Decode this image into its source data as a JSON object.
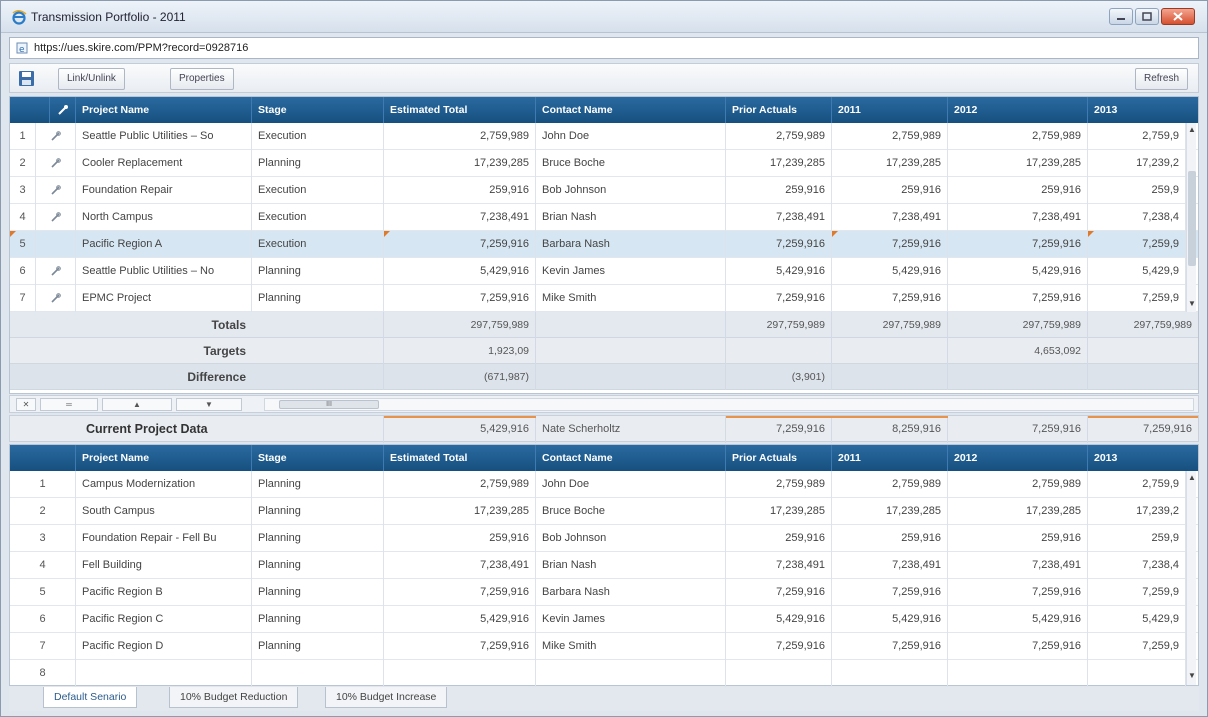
{
  "window": {
    "title": "Transmission Portfolio - 2011",
    "url": "https://ues.skire.com/PPM?record=0928716"
  },
  "toolbar": {
    "link_unlink": "Link/Unlink",
    "properties": "Properties",
    "refresh": "Refresh"
  },
  "columns": [
    "Project Name",
    "Stage",
    "Estimated Total",
    "Contact Name",
    "Prior Actuals",
    "2011",
    "2012",
    "2013"
  ],
  "top_rows": [
    {
      "idx": "1",
      "linked": true,
      "name": "Seattle Public Utilities – So",
      "stage": "Execution",
      "est": "2,759,989",
      "contact": "John Doe",
      "prior": "2,759,989",
      "y2011": "2,759,989",
      "y2012": "2,759,989",
      "y2013": "2,759,9"
    },
    {
      "idx": "2",
      "linked": true,
      "name": "Cooler Replacement",
      "stage": "Planning",
      "est": "17,239,285",
      "contact": "Bruce Boche",
      "prior": "17,239,285",
      "y2011": "17,239,285",
      "y2012": "17,239,285",
      "y2013": "17,239,2"
    },
    {
      "idx": "3",
      "linked": true,
      "name": "Foundation Repair",
      "stage": "Execution",
      "est": "259,916",
      "contact": "Bob Johnson",
      "prior": "259,916",
      "y2011": "259,916",
      "y2012": "259,916",
      "y2013": "259,9"
    },
    {
      "idx": "4",
      "linked": true,
      "name": "North Campus",
      "stage": "Execution",
      "est": "7,238,491",
      "contact": "Brian Nash",
      "prior": "7,238,491",
      "y2011": "7,238,491",
      "y2012": "7,238,491",
      "y2013": "7,238,4"
    },
    {
      "idx": "5",
      "linked": false,
      "name": "Pacific Region A",
      "stage": "Execution",
      "est": "7,259,916",
      "contact": "Barbara Nash",
      "prior": "7,259,916",
      "y2011": "7,259,916",
      "y2012": "7,259,916",
      "y2013": "7,259,9"
    },
    {
      "idx": "6",
      "linked": true,
      "name": "Seattle Public Utilities – No",
      "stage": "Planning",
      "est": "5,429,916",
      "contact": "Kevin James",
      "prior": "5,429,916",
      "y2011": "5,429,916",
      "y2012": "5,429,916",
      "y2013": "5,429,9"
    },
    {
      "idx": "7",
      "linked": true,
      "name": "EPMC Project",
      "stage": "Planning",
      "est": "7,259,916",
      "contact": "Mike Smith",
      "prior": "7,259,916",
      "y2011": "7,259,916",
      "y2012": "7,259,916",
      "y2013": "7,259,9"
    }
  ],
  "totals": {
    "label": "Totals",
    "est": "297,759,989",
    "prior": "297,759,989",
    "y2011": "297,759,989",
    "y2012": "297,759,989",
    "y2013": "297,759,989"
  },
  "targets": {
    "label": "Targets",
    "est": "1,923,09",
    "y2012": "4,653,092"
  },
  "difference": {
    "label": "Difference",
    "est": "(671,987)",
    "prior": "(3,901)"
  },
  "splitter": {
    "thumb": "III"
  },
  "current": {
    "label": "Current Project Data",
    "est": "5,429,916",
    "contact": "Nate Scherholtz",
    "prior": "7,259,916",
    "y2011": "8,259,916",
    "y2012": "7,259,916",
    "y2013": "7,259,916"
  },
  "bottom_rows": [
    {
      "idx": "1",
      "name": "Campus Modernization",
      "stage": "Planning",
      "est": "2,759,989",
      "contact": "John Doe",
      "prior": "2,759,989",
      "y2011": "2,759,989",
      "y2012": "2,759,989",
      "y2013": "2,759,9"
    },
    {
      "idx": "2",
      "name": "South Campus",
      "stage": "Planning",
      "est": "17,239,285",
      "contact": "Bruce Boche",
      "prior": "17,239,285",
      "y2011": "17,239,285",
      "y2012": "17,239,285",
      "y2013": "17,239,2"
    },
    {
      "idx": "3",
      "name": "Foundation Repair - Fell Bu",
      "stage": "Planning",
      "est": "259,916",
      "contact": "Bob Johnson",
      "prior": "259,916",
      "y2011": "259,916",
      "y2012": "259,916",
      "y2013": "259,9"
    },
    {
      "idx": "4",
      "name": "Fell Building",
      "stage": "Planning",
      "est": "7,238,491",
      "contact": "Brian Nash",
      "prior": "7,238,491",
      "y2011": "7,238,491",
      "y2012": "7,238,491",
      "y2013": "7,238,4"
    },
    {
      "idx": "5",
      "name": "Pacific Region B",
      "stage": "Planning",
      "est": "7,259,916",
      "contact": "Barbara Nash",
      "prior": "7,259,916",
      "y2011": "7,259,916",
      "y2012": "7,259,916",
      "y2013": "7,259,9"
    },
    {
      "idx": "6",
      "name": "Pacific Region C",
      "stage": "Planning",
      "est": "5,429,916",
      "contact": "Kevin James",
      "prior": "5,429,916",
      "y2011": "5,429,916",
      "y2012": "5,429,916",
      "y2013": "5,429,9"
    },
    {
      "idx": "7",
      "name": "Pacific Region D",
      "stage": "Planning",
      "est": "7,259,916",
      "contact": "Mike Smith",
      "prior": "7,259,916",
      "y2011": "7,259,916",
      "y2012": "7,259,916",
      "y2013": "7,259,9"
    },
    {
      "idx": "8",
      "name": "",
      "stage": "",
      "est": "",
      "contact": "",
      "prior": "",
      "y2011": "",
      "y2012": "",
      "y2013": ""
    }
  ],
  "tabs": [
    "Default Senario",
    "10% Budget Reduction",
    "10% Budget Increase"
  ],
  "icons": {
    "browser": "ie-icon",
    "page": "page-icon",
    "save": "save-icon",
    "link": "link-icon"
  },
  "colors": {
    "header": "#1d5a8c",
    "selected_row": "#d6e6f2",
    "accent": "#e07a2b"
  }
}
